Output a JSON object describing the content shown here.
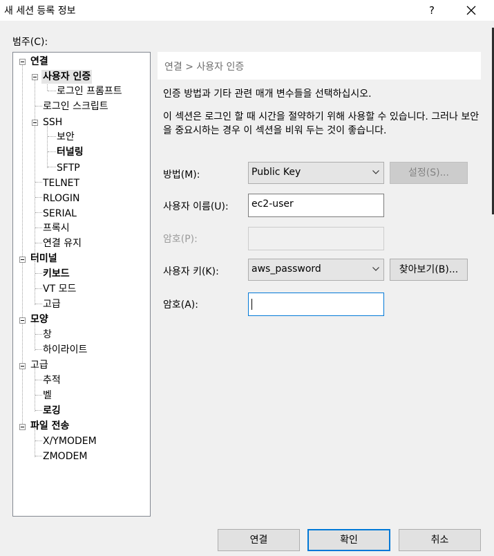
{
  "window": {
    "title": "새 세션 등록 정보",
    "help": "?"
  },
  "category_label": "범주(C):",
  "tree": {
    "connection": "연결",
    "user_auth": "사용자 인증",
    "login_prompt": "로그인 프롬프트",
    "login_script": "로그인 스크립트",
    "ssh": "SSH",
    "security": "보안",
    "tunneling": "터널링",
    "sftp": "SFTP",
    "telnet": "TELNET",
    "rlogin": "RLOGIN",
    "serial": "SERIAL",
    "proxy": "프록시",
    "keepalive": "연결 유지",
    "terminal": "터미널",
    "keyboard": "키보드",
    "vt_mode": "VT 모드",
    "terminal_advanced": "고급",
    "appearance": "모양",
    "window": "창",
    "highlight": "하이라이트",
    "advanced": "고급",
    "trace": "추적",
    "bell": "벨",
    "logging": "로깅",
    "file_transfer": "파일 전송",
    "xymodem": "X/YMODEM",
    "zmodem": "ZMODEM"
  },
  "header": {
    "breadcrumb": "연결 > 사용자 인증"
  },
  "description": {
    "line1": "인증 방법과 기타 관련 매개 변수들을 선택하십시오.",
    "line2": "이 섹션은 로그인 할 때 시간을 절약하기 위해 사용할 수 있습니다. 그러나 보안을 중요시하는 경우 이 섹션을 비워 두는 것이 좋습니다."
  },
  "form": {
    "method_label": "방법(M):",
    "method_value": "Public Key",
    "setup_button": "설정(S)...",
    "username_label": "사용자 이름(U):",
    "username_value": "ec2-user",
    "password_label": "암호(P):",
    "password_value": "",
    "userkey_label": "사용자 키(K):",
    "userkey_value": "aws_password",
    "browse_button": "찾아보기(B)...",
    "passphrase_label": "암호(A):",
    "passphrase_value": ""
  },
  "buttons": {
    "connect": "연결",
    "ok": "확인",
    "cancel": "취소"
  },
  "colors": {
    "accent": "#0078d7",
    "dialog_bg": "#f0f0f0"
  }
}
